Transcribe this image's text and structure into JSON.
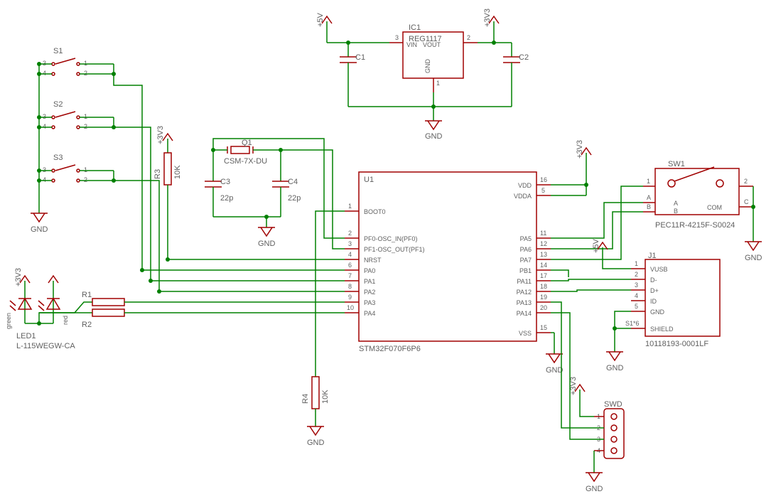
{
  "regulator": {
    "ref": "IC1",
    "value": "REG1117",
    "pins": {
      "vin": "VIN",
      "vout": "VOUT",
      "gnd": "GND",
      "pin1": "1",
      "pin2": "2",
      "pin3": "3"
    },
    "caps": [
      {
        "ref": "C1",
        "value": ""
      },
      {
        "ref": "C2",
        "value": ""
      }
    ],
    "rails": [
      "+5V",
      "+3V3"
    ],
    "gnd": "GND"
  },
  "mcu": {
    "ref": "U1",
    "value": "STM32F070F6P6",
    "left": [
      {
        "n": "1",
        "l": "BOOT0"
      },
      {
        "n": "2",
        "l": "PF0-OSC_IN(PF0)"
      },
      {
        "n": "3",
        "l": "PF1-OSC_OUT(PF1)"
      },
      {
        "n": "4",
        "l": "NRST"
      },
      {
        "n": "6",
        "l": "PA0"
      },
      {
        "n": "7",
        "l": "PA1"
      },
      {
        "n": "8",
        "l": "PA2"
      },
      {
        "n": "9",
        "l": "PA3"
      },
      {
        "n": "10",
        "l": "PA4"
      }
    ],
    "right": [
      {
        "n": "16",
        "l": "VDD"
      },
      {
        "n": "5",
        "l": "VDDA"
      },
      {
        "n": "11",
        "l": "PA5"
      },
      {
        "n": "12",
        "l": "PA6"
      },
      {
        "n": "13",
        "l": "PA7"
      },
      {
        "n": "14",
        "l": "PB1"
      },
      {
        "n": "17",
        "l": "PA11"
      },
      {
        "n": "18",
        "l": "PA12"
      },
      {
        "n": "19",
        "l": "PA13"
      },
      {
        "n": "20",
        "l": "PA14"
      },
      {
        "n": "15",
        "l": "VSS"
      }
    ]
  },
  "switches": [
    {
      "ref": "S1"
    },
    {
      "ref": "S2"
    },
    {
      "ref": "S3"
    }
  ],
  "switch_pins": [
    "1",
    "2",
    "3",
    "4"
  ],
  "crystal": {
    "ref": "Q1",
    "value": "CSM-7X-DU",
    "caps": [
      {
        "ref": "C3",
        "value": "22p"
      },
      {
        "ref": "C4",
        "value": "22p"
      }
    ],
    "gnd": "GND"
  },
  "led": {
    "ref": "LED1",
    "value": "L-115WEGW-CA",
    "colors": [
      "green",
      "red"
    ]
  },
  "resistors": [
    {
      "ref": "R1"
    },
    {
      "ref": "R2"
    },
    {
      "ref": "R3",
      "value": "10K"
    },
    {
      "ref": "R4",
      "value": "10K"
    }
  ],
  "encoder": {
    "ref": "SW1",
    "value": "PEC11R-4215F-S0024",
    "pins": [
      "1",
      "2",
      "A",
      "B",
      "C"
    ],
    "labels": [
      "A",
      "B",
      "COM"
    ],
    "gnd": "GND"
  },
  "usb": {
    "ref": "J1",
    "value": "10118193-0001LF",
    "rows": [
      "VUSB",
      "D-",
      "D+",
      "ID",
      "GND",
      "SHIELD"
    ],
    "pins": [
      "1",
      "2",
      "3",
      "4",
      "5",
      "S1*6"
    ],
    "rail": "+5V",
    "gnd": "GND"
  },
  "swd": {
    "ref": "SWD",
    "pins": [
      "1",
      "2",
      "3",
      "4"
    ],
    "rail": "+3V3",
    "gnd": "GND"
  },
  "gnd_label": "GND",
  "rail_3v3": "+3V3",
  "rail_5v": "+5V"
}
